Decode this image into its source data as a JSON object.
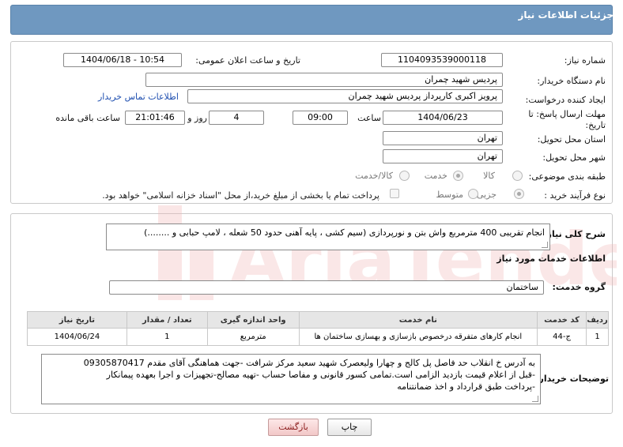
{
  "header": {
    "title": "جزئیات اطلاعات نیاز"
  },
  "form": {
    "need_number_label": "شماره نیاز:",
    "need_number": "1104093539000118",
    "announce_label": "تاریخ و ساعت اعلان عمومی:",
    "announce_value": "1404/06/18 - 10:54",
    "buyer_org_label": "نام دستگاه خریدار:",
    "buyer_org": "پردیس شهید چمران",
    "requester_label": "ایجاد کننده درخواست:",
    "requester": "پرویز اکبری کارپرداز پردیس شهید چمران",
    "contact_link": "اطلاعات تماس خریدار",
    "deadline_label_1": "مهلت ارسال پاسخ: تا",
    "deadline_label_2": "تاریخ:",
    "deadline_date": "1404/06/23",
    "time_label": "ساعت",
    "deadline_time": "09:00",
    "days_value": "4",
    "days_label": "روز و",
    "remaining_value": "21:01:46",
    "remaining_label": "ساعت باقی مانده",
    "province_label": "استان محل تحویل:",
    "province": "تهران",
    "city_label": "شهر محل تحویل:",
    "city": "تهران",
    "category_label": "طبقه بندی موضوعی:",
    "category_options": [
      "کالا",
      "خدمت",
      "کالا/خدمت"
    ],
    "category_selected": "خدمت",
    "process_label": "نوع فرآیند خرید :",
    "process_options": [
      "جزیی",
      "متوسط"
    ],
    "process_selected": "جزیی",
    "treasury_note": "پرداخت تمام یا بخشی از مبلغ خرید،از محل \"اسناد خزانه اسلامی\" خواهد بود."
  },
  "need": {
    "summary_label": "شرح کلی نیاز:",
    "summary_text": "انجام تقریبی 400 مترمربع واش بتن و نورپردازی (سیم کشی ، پایه آهنی حدود 50 شعله ، لامپ حبابی و ........)",
    "services_title": "اطلاعات خدمات مورد نیاز",
    "service_group_label": "گروه خدمت:",
    "service_group": "ساختمان"
  },
  "table": {
    "headers": [
      "ردیف",
      "کد خدمت",
      "نام خدمت",
      "واحد اندازه گیری",
      "تعداد / مقدار",
      "تاریخ نیاز"
    ],
    "rows": [
      [
        "1",
        "ج-44",
        "انجام کارهای متفرقه درخصوص بازسازی و بهسازی ساختمان ها",
        "مترمربع",
        "1",
        "1404/06/24"
      ]
    ]
  },
  "buyer_notes": {
    "label": "توضیحات خریدار:",
    "lines": [
      "به آدرس خ انقلاب حد فاصل پل کالج و چهارا ولیعصرک شهید سعید مرکز شرافت -جهت هماهنگی آقای مقدم 09305870417",
      "-قبل از اعلام قیمت بازدید الزامی است.تمامی کسور قانونی و مفاصا حساب -تهیه مصالح-تجهیزات و اجرا بعهده پیمانکار",
      "-پرداخت طبق قرارداد و اخذ ضمانتنامه"
    ]
  },
  "buttons": {
    "print": "چاپ",
    "back": "بازگشت"
  },
  "colors": {
    "header": "#6f98c0",
    "link": "#1f4fb0",
    "back_text": "#8a1a1a"
  }
}
